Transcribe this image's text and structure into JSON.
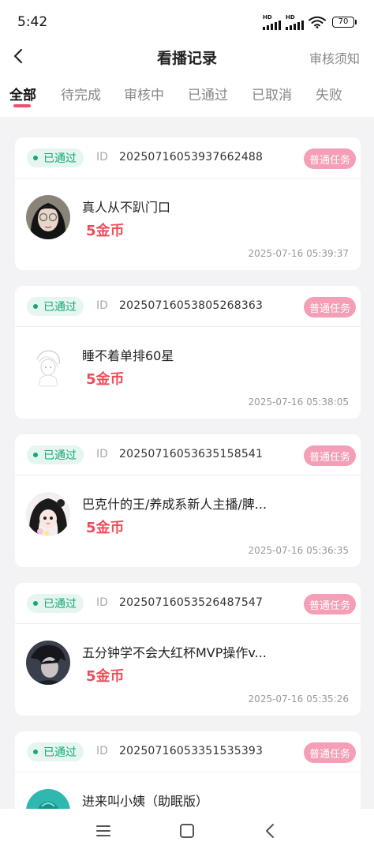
{
  "status_bar": {
    "time": "5:42",
    "signal_labels": [
      "HD",
      "HD"
    ],
    "icons": [
      "signal-icon",
      "signal-icon",
      "wifi-icon",
      "battery-icon"
    ],
    "battery_level": "70"
  },
  "header": {
    "title": "看播记录",
    "right_link": "审核须知",
    "back_icon": "back-arrow-icon"
  },
  "tabs": [
    {
      "label": "全部",
      "active": true
    },
    {
      "label": "待完成",
      "active": false
    },
    {
      "label": "审核中",
      "active": false
    },
    {
      "label": "已通过",
      "active": false
    },
    {
      "label": "已取消",
      "active": false
    },
    {
      "label": "失败",
      "active": false
    }
  ],
  "colors": {
    "accent": "#f0506e",
    "status_green": "#17a77b",
    "status_bg": "#e4f6ef",
    "type_badge": "#f49fb5",
    "coin_red": "#ef4c5a"
  },
  "records": [
    {
      "status": "已通过",
      "id_label": "ID",
      "id": "20250716053937662488",
      "type": "普通任务",
      "title": "真人从不趴门口",
      "reward": "5金币",
      "time": "2025-07-16 05:39:37"
    },
    {
      "status": "已通过",
      "id_label": "ID",
      "id": "20250716053805268363",
      "type": "普通任务",
      "title": "睡不着单排60星",
      "reward": "5金币",
      "time": "2025-07-16 05:38:05"
    },
    {
      "status": "已通过",
      "id_label": "ID",
      "id": "20250716053635158541",
      "type": "普通任务",
      "title": "巴克什的王/养成系新人主播/脾...",
      "reward": "5金币",
      "time": "2025-07-16 05:36:35"
    },
    {
      "status": "已通过",
      "id_label": "ID",
      "id": "20250716053526487547",
      "type": "普通任务",
      "title": "五分钟学不会大红杯MVP操作v...",
      "reward": "5金币",
      "time": "2025-07-16 05:35:26"
    },
    {
      "status": "已通过",
      "id_label": "ID",
      "id": "20250716053351535393",
      "type": "普通任务",
      "title": "进来叫小姨（助眠版）",
      "reward": "",
      "time": ""
    }
  ],
  "bottom_nav": [
    "menu-icon",
    "home-icon",
    "back-icon"
  ]
}
